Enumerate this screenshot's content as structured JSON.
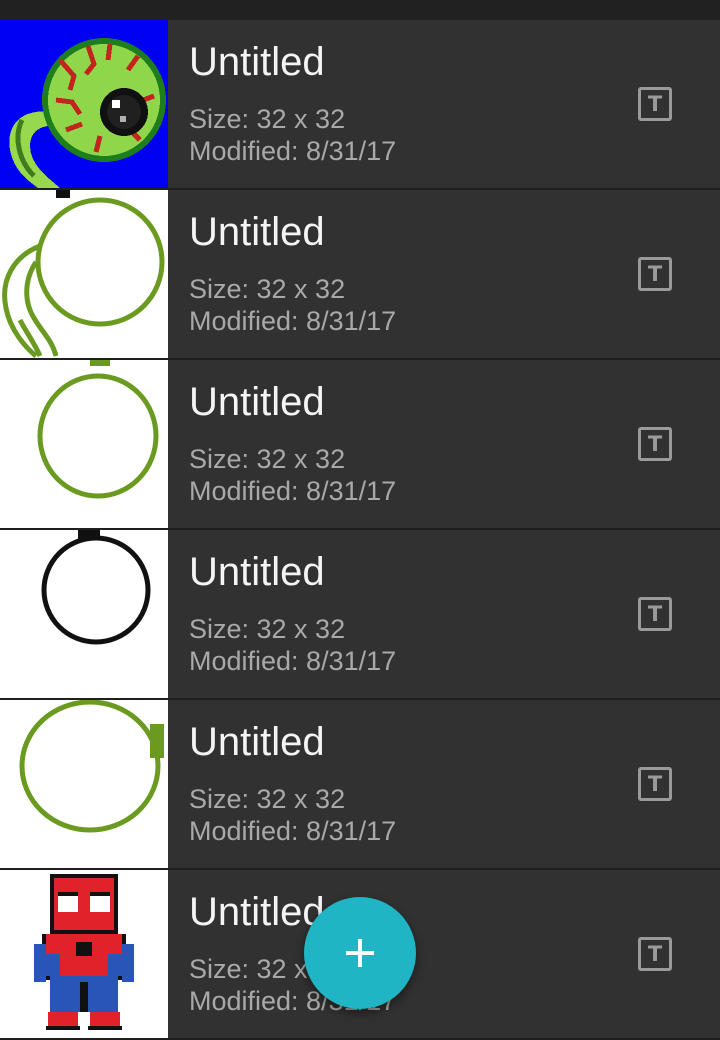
{
  "colors": {
    "background": "#303030",
    "status_bar": "#212121",
    "fab": "#1fb5c4",
    "title_text": "#f4f4f4",
    "meta_text": "#a9a9a9",
    "icon": "#9a9a9a"
  },
  "projects": [
    {
      "title": "Untitled",
      "size": "Size: 32 x 32",
      "modified": "Modified: 8/31/17",
      "thumbnail_icon": "green-eyeball-drawing-icon",
      "rename_icon_glyph": "T"
    },
    {
      "title": "Untitled",
      "size": "Size: 32 x 32",
      "modified": "Modified: 8/31/17",
      "thumbnail_icon": "eyeball-outline-drawing-icon",
      "rename_icon_glyph": "T"
    },
    {
      "title": "Untitled",
      "size": "Size: 32 x 32",
      "modified": "Modified: 8/31/17",
      "thumbnail_icon": "green-circle-drawing-icon",
      "rename_icon_glyph": "T"
    },
    {
      "title": "Untitled",
      "size": "Size: 32 x 32",
      "modified": "Modified: 8/31/17",
      "thumbnail_icon": "black-circle-drawing-icon",
      "rename_icon_glyph": "T"
    },
    {
      "title": "Untitled",
      "size": "Size: 32 x 32",
      "modified": "Modified: 8/31/17",
      "thumbnail_icon": "green-circle-drawing-icon",
      "rename_icon_glyph": "T"
    },
    {
      "title": "Untitled",
      "size": "Size: 32 x 32",
      "modified": "Modified: 8/31/17",
      "thumbnail_icon": "spiderman-sprite-icon",
      "rename_icon_glyph": "T"
    }
  ],
  "fab": {
    "icon": "plus-icon"
  }
}
